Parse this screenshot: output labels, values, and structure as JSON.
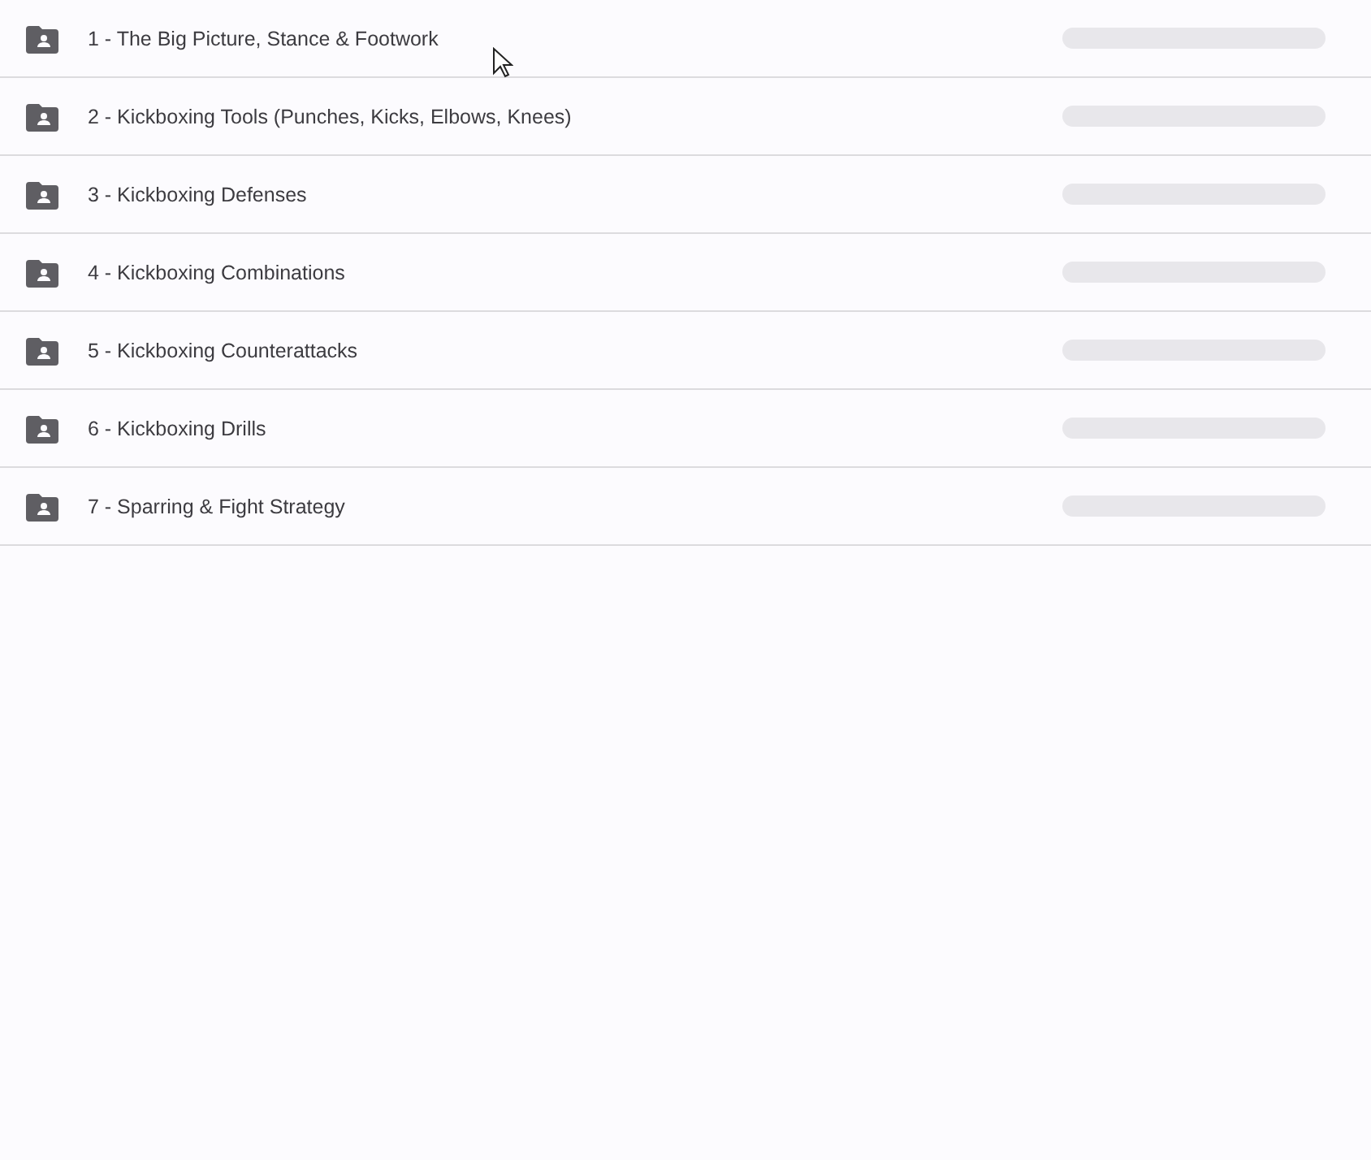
{
  "folders": [
    {
      "name": "1 - The Big Picture, Stance & Footwork"
    },
    {
      "name": "2 - Kickboxing Tools (Punches, Kicks, Elbows, Knees)"
    },
    {
      "name": "3 - Kickboxing Defenses"
    },
    {
      "name": "4 - Kickboxing Combinations"
    },
    {
      "name": "5 - Kickboxing Counterattacks"
    },
    {
      "name": "6 - Kickboxing Drills"
    },
    {
      "name": "7 - Sparring & Fight Strategy"
    }
  ]
}
